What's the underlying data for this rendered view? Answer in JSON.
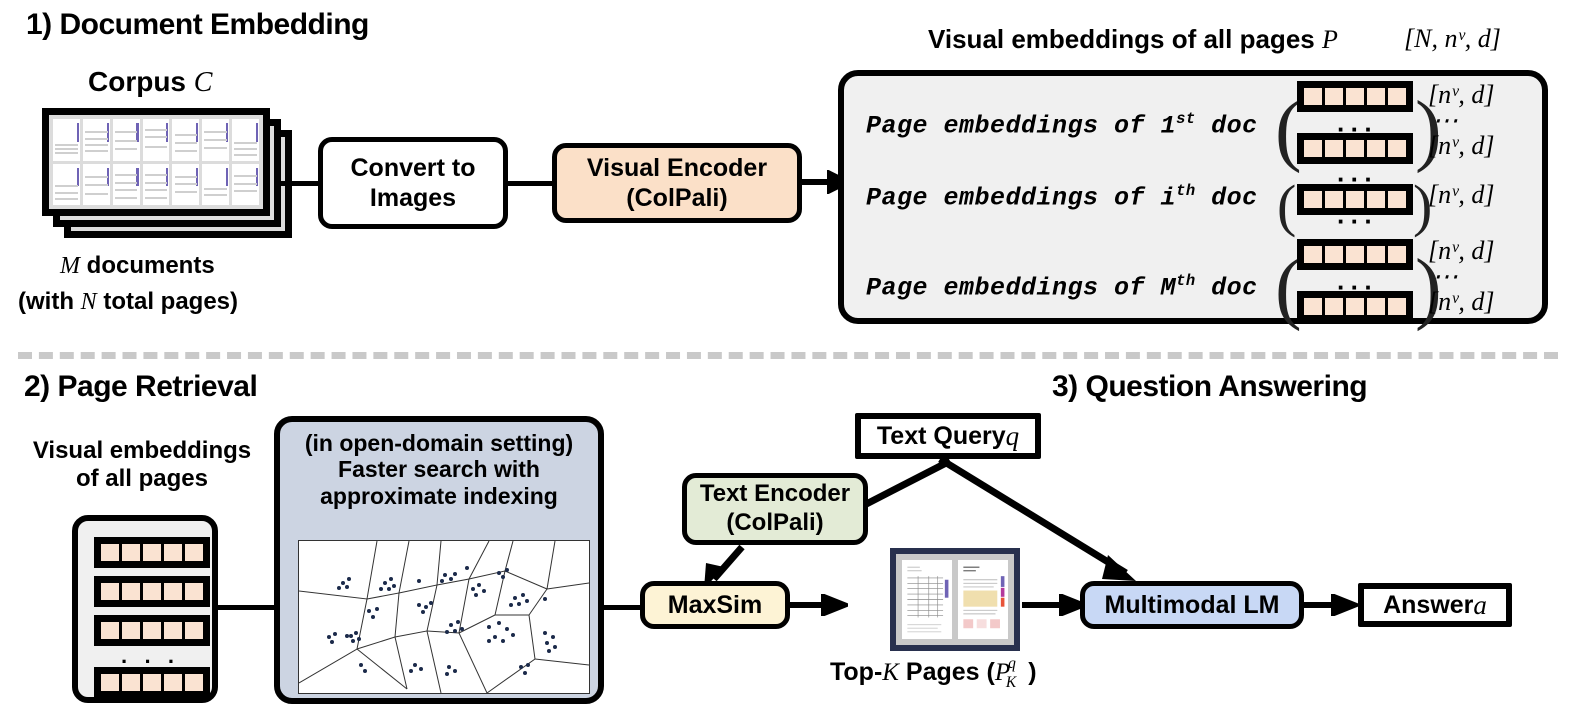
{
  "sections": {
    "s1": {
      "title": "1) Document Embedding"
    },
    "s2": {
      "title": "2) Page Retrieval"
    },
    "s3": {
      "title": "3) Question Answering"
    }
  },
  "corpus": {
    "title_text": "Corpus ",
    "title_sym": "C",
    "caption_line1_pre": "M",
    "caption_line1_post": " documents",
    "caption_line2_pre": "(with ",
    "caption_line2_sym": "N",
    "caption_line2_post": " total pages)"
  },
  "nodes": {
    "convert": "Convert to\nImages",
    "convert_l1": "Convert to",
    "convert_l2": "Images",
    "visual_encoder_l1": "Visual Encoder",
    "visual_encoder_l2": "(ColPali)",
    "text_encoder_l1": "Text Encoder",
    "text_encoder_l2": "(ColPali)",
    "maxsim": "MaxSim",
    "multimodal_lm": "Multimodal LM",
    "text_query_text": "Text Query ",
    "text_query_sym": "q",
    "answer_text": "Answer ",
    "answer_sym": "a",
    "opendomain_l1": "(in open-domain setting)",
    "opendomain_l2": "Faster search with",
    "opendomain_l3": "approximate indexing"
  },
  "embeddings_panel": {
    "heading_text": "Visual embeddings of all pages ",
    "heading_sym": "P",
    "heading_shape": "[N, nᵛ, d]",
    "rows": [
      {
        "label_pre": "Page embeddings of ",
        "label_ord": "1",
        "label_sup": "st",
        "label_post": " doc",
        "shapes": [
          "[nᵛ, d]",
          "⋯",
          "[nᵛ, d]"
        ],
        "vectors": 2,
        "ellipsis_between": true
      },
      {
        "label_pre": "Page embeddings of ",
        "label_ord": "i",
        "label_sup": "th",
        "label_post": " doc",
        "shapes": [
          "[nᵛ, d]"
        ],
        "vectors": 1,
        "ellipsis_between": false
      },
      {
        "label_pre": "Page embeddings of ",
        "label_ord": "M",
        "label_sup": "th",
        "label_post": " doc",
        "shapes": [
          "[nᵛ, d]",
          "⋯",
          "[nᵛ, d]"
        ],
        "vectors": 2,
        "ellipsis_between": true
      }
    ],
    "cells_per_vector": 5,
    "ellipsis": "···"
  },
  "retrieval": {
    "embeddings_caption_l1": "Visual embeddings",
    "embeddings_caption_l2": "of all pages",
    "vector_rows": 4,
    "cells_per_vector": 5,
    "ellipsis": "· · ·"
  },
  "topk": {
    "caption_pre": "Top-",
    "caption_sym": "K",
    "caption_mid": " Pages (",
    "caption_sub_base": "P",
    "caption_sub_sup": "q",
    "caption_sub_sub": "K",
    "caption_post": ")"
  },
  "colors": {
    "visual_encoder_fill": "#fbe0c8",
    "text_encoder_fill": "#e3ebd6",
    "maxsim_fill": "#fdf3d5",
    "multimodal_fill": "#c8d8f5",
    "opendomain_fill": "#ccd4e2",
    "panel_fill": "#f0f0f0",
    "cell_fill": "#fae3d2",
    "divider": "#c9c9c9",
    "topk_border": "#28304e",
    "stroke": "#000000"
  }
}
